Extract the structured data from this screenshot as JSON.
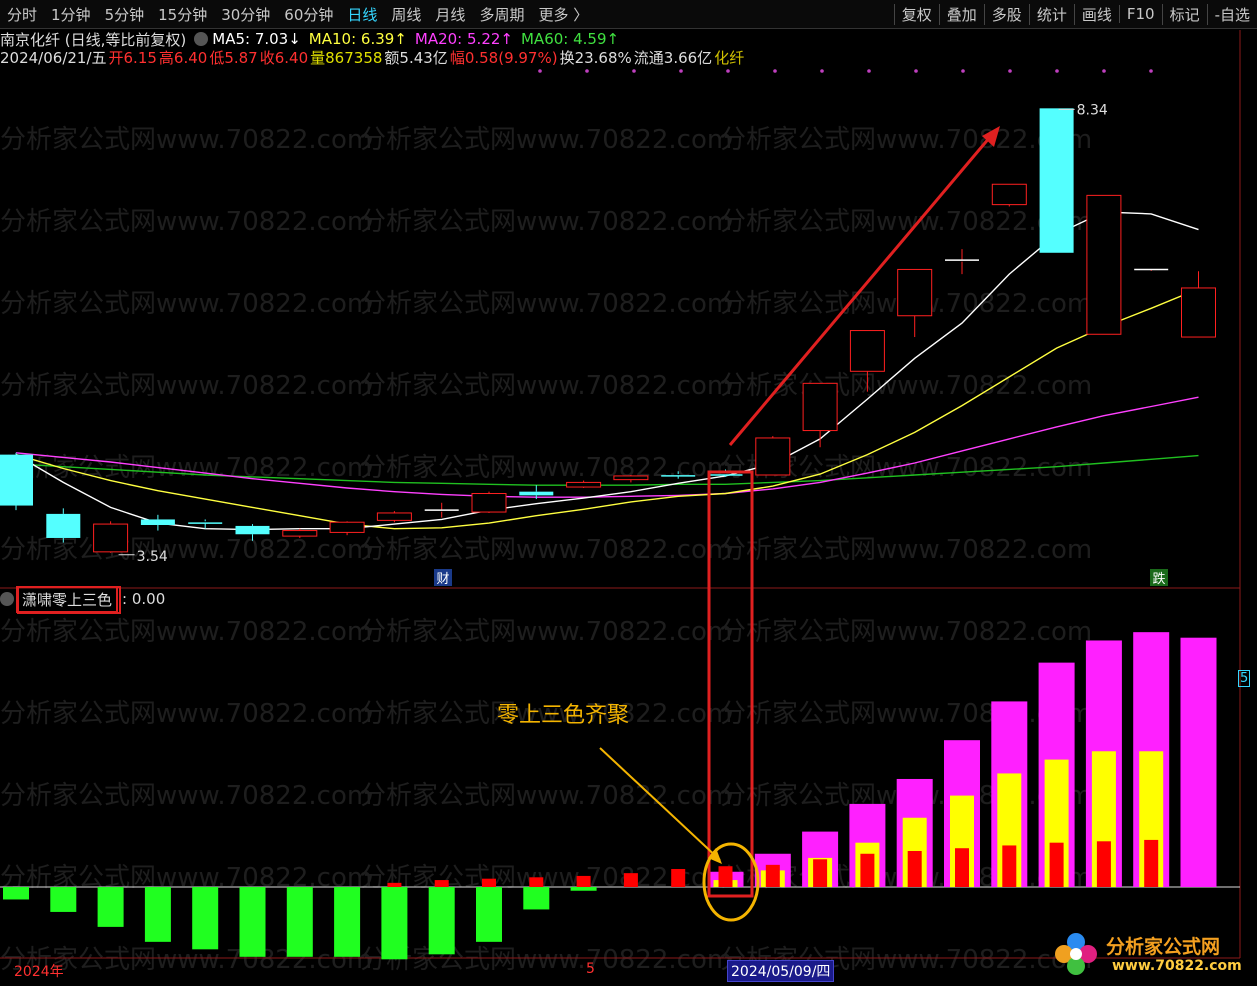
{
  "toolbar": {
    "tabs": [
      "分时",
      "1分钟",
      "5分钟",
      "15分钟",
      "30分钟",
      "60分钟",
      "日线",
      "周线",
      "月线",
      "多周期",
      "更多 〉"
    ],
    "active_tab": "日线",
    "right_tabs": [
      "复权",
      "叠加",
      "多股",
      "统计",
      "画线",
      "F10",
      "标记",
      "-自选"
    ]
  },
  "header": {
    "title": "南京化纤 (日线,等比前复权)",
    "ma5_label": "MA5: 7.03↓",
    "ma10_label": "MA10: 6.39↑",
    "ma20_label": "MA20: 5.22↑",
    "ma60_label": "MA60: 4.59↑",
    "date": "2024/06/21/五",
    "open": "开6.15",
    "high": "高6.40",
    "low": "低5.87",
    "close": "收6.40",
    "volume": "量867358",
    "amount": "额5.43亿",
    "change": "幅0.58(9.97%)",
    "turnover": "换23.68%",
    "float": "流通3.66亿",
    "name_short": "化纤"
  },
  "price_chart": {
    "high_label": "8.34",
    "low_label": "3.54",
    "marker_cai": "财",
    "marker_die": "跌"
  },
  "indicator": {
    "name": "潇啸零上三色",
    "value": ": 0.00",
    "annotation": "零上三色齐聚",
    "right_tick": "5"
  },
  "bottom": {
    "year": "2024年",
    "month": "5",
    "cursor_date": "2024/05/09/四"
  },
  "watermark": {
    "text": "分析家公式网www.70822.com",
    "logo_text": "分析家公式网",
    "logo_url": "www.70822.com"
  },
  "colors": {
    "up": "#ff2020",
    "down_cyan": "#54ffff",
    "ma5": "#ffffff",
    "ma10": "#ffff40",
    "ma20": "#ff40ff",
    "ma60": "#20c020",
    "neg_bar": "#20ff20",
    "pos_magenta": "#ff20ff",
    "pos_yellow": "#ffff00",
    "pos_red": "#ff0000",
    "annotation": "#f4b400"
  },
  "chart_data": {
    "type": "candlestick+bar",
    "candles": [
      {
        "o": 4.6,
        "c": 4.05,
        "h": 4.62,
        "l": 4.0
      },
      {
        "o": 3.96,
        "c": 3.7,
        "h": 4.02,
        "l": 3.65
      },
      {
        "o": 3.55,
        "c": 3.85,
        "h": 3.88,
        "l": 3.54
      },
      {
        "o": 3.9,
        "c": 3.84,
        "h": 3.95,
        "l": 3.78
      },
      {
        "o": 3.88,
        "c": 3.86,
        "h": 3.9,
        "l": 3.8
      },
      {
        "o": 3.83,
        "c": 3.74,
        "h": 3.85,
        "l": 3.67
      },
      {
        "o": 3.72,
        "c": 3.78,
        "h": 3.8,
        "l": 3.7
      },
      {
        "o": 3.76,
        "c": 3.87,
        "h": 3.88,
        "l": 3.73
      },
      {
        "o": 3.89,
        "c": 3.97,
        "h": 3.99,
        "l": 3.87
      },
      {
        "o": 4.0,
        "c": 4.0,
        "h": 4.08,
        "l": 3.92
      },
      {
        "o": 3.98,
        "c": 4.18,
        "h": 4.2,
        "l": 3.97
      },
      {
        "o": 4.2,
        "c": 4.16,
        "h": 4.27,
        "l": 4.12
      },
      {
        "o": 4.25,
        "c": 4.3,
        "h": 4.32,
        "l": 4.24
      },
      {
        "o": 4.33,
        "c": 4.37,
        "h": 4.38,
        "l": 4.3
      },
      {
        "o": 4.39,
        "c": 4.37,
        "h": 4.42,
        "l": 4.34
      },
      {
        "o": 4.4,
        "c": 4.38,
        "h": 4.44,
        "l": 4.36
      },
      {
        "o": 4.38,
        "c": 4.78,
        "h": 4.8,
        "l": 4.38
      },
      {
        "o": 4.86,
        "c": 5.37,
        "h": 5.37,
        "l": 4.68
      },
      {
        "o": 5.5,
        "c": 5.94,
        "h": 5.94,
        "l": 5.28
      },
      {
        "o": 6.1,
        "c": 6.6,
        "h": 6.6,
        "l": 5.87
      },
      {
        "o": 6.7,
        "c": 6.7,
        "h": 6.82,
        "l": 6.55
      },
      {
        "o": 7.3,
        "c": 7.52,
        "h": 7.52,
        "l": 7.28
      },
      {
        "o": 8.34,
        "c": 6.78,
        "h": 8.34,
        "l": 6.78
      },
      {
        "o": 5.9,
        "c": 7.4,
        "h": 7.4,
        "l": 5.9
      },
      {
        "o": 6.6,
        "c": 6.6,
        "h": 6.6,
        "l": 6.6
      },
      {
        "o": 5.87,
        "c": 6.4,
        "h": 6.58,
        "l": 5.87
      }
    ],
    "ma5": [
      4.6,
      4.3,
      4.03,
      3.86,
      3.8,
      3.79,
      3.8,
      3.8,
      3.85,
      3.9,
      4.0,
      4.07,
      4.13,
      4.2,
      4.29,
      4.37,
      4.5,
      4.77,
      5.2,
      5.64,
      6.02,
      6.55,
      6.98,
      7.22,
      7.2,
      7.03
    ],
    "ma10": [
      4.6,
      4.45,
      4.32,
      4.21,
      4.12,
      4.03,
      3.94,
      3.85,
      3.8,
      3.81,
      3.86,
      3.94,
      4.01,
      4.09,
      4.15,
      4.18,
      4.26,
      4.39,
      4.6,
      4.84,
      5.13,
      5.44,
      5.75,
      5.98,
      6.18,
      6.39
    ],
    "ma20": [
      4.62,
      4.57,
      4.52,
      4.46,
      4.4,
      4.34,
      4.29,
      4.24,
      4.2,
      4.17,
      4.15,
      4.14,
      4.14,
      4.15,
      4.16,
      4.18,
      4.23,
      4.3,
      4.4,
      4.51,
      4.64,
      4.77,
      4.9,
      5.02,
      5.12,
      5.22
    ],
    "ma60": [
      4.5,
      4.47,
      4.44,
      4.41,
      4.38,
      4.36,
      4.34,
      4.32,
      4.3,
      4.29,
      4.28,
      4.27,
      4.27,
      4.27,
      4.28,
      4.28,
      4.3,
      4.32,
      4.35,
      4.38,
      4.41,
      4.44,
      4.47,
      4.51,
      4.55,
      4.59
    ],
    "indicator_neg": [
      -0.5,
      -1.0,
      -1.6,
      -2.2,
      -2.5,
      -2.8,
      -2.8,
      -2.8,
      -2.9,
      -2.7,
      -2.2,
      -0.9,
      -0.15,
      0,
      0,
      0,
      0,
      0,
      0,
      0,
      0,
      0,
      0,
      0,
      0,
      0
    ],
    "indicator_red": [
      0,
      0,
      0,
      0,
      0,
      0,
      0,
      0,
      0.15,
      0.25,
      0.3,
      0.35,
      0.4,
      0.5,
      0.65,
      0.75,
      0.8,
      1.0,
      1.2,
      1.3,
      1.4,
      1.5,
      1.6,
      1.65,
      1.7,
      0
    ],
    "indicator_yellow": [
      0,
      0,
      0,
      0,
      0,
      0,
      0,
      0,
      0,
      0,
      0,
      0,
      0,
      0,
      0,
      0.25,
      0.6,
      1.05,
      1.6,
      2.5,
      3.3,
      4.1,
      4.6,
      4.9,
      4.9,
      0
    ],
    "indicator_magenta": [
      0,
      0,
      0,
      0,
      0,
      0,
      0,
      0,
      0,
      0,
      0,
      0,
      0,
      0,
      0,
      0.55,
      1.2,
      2.0,
      3.0,
      3.9,
      5.3,
      6.7,
      8.1,
      8.9,
      9.2,
      9.0
    ],
    "price_range": [
      3.3,
      8.7
    ],
    "indicator_range": [
      -3.4,
      10.0
    ]
  }
}
